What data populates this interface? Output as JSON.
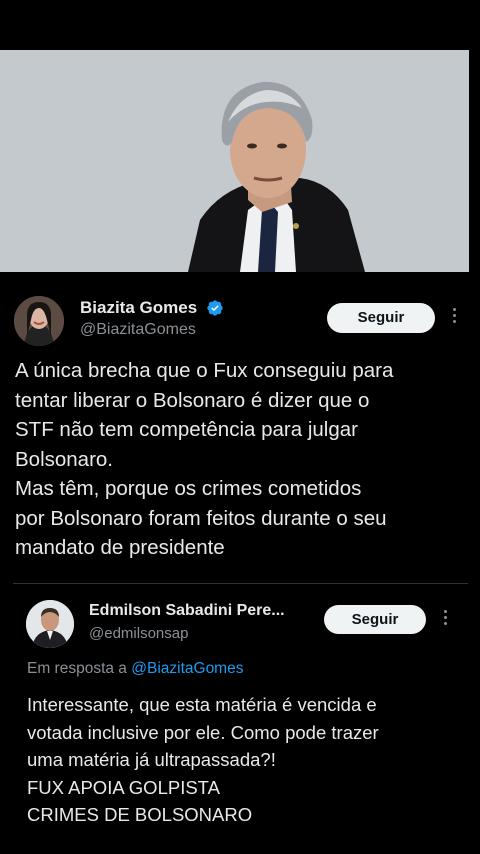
{
  "post": {
    "image_alt_icon": "photo-of-man-in-judicial-robe",
    "author": {
      "display_name": "Biazita Gomes",
      "handle": "@BiazitaGomes",
      "verified_icon": "verified-badge-icon"
    },
    "follow_label": "Seguir",
    "more_icon": "more-vertical-icon",
    "text_lines": [
      "A única brecha que o Fux  conseguiu para",
      "tentar liberar o Bolsonaro é dizer que o",
      "STF não tem competência para julgar",
      "Bolsonaro.",
      "Mas têm, porque os crimes cometidos",
      "por Bolsonaro foram feitos durante o seu",
      "mandato de presidente"
    ]
  },
  "reply": {
    "author": {
      "display_name": "Edmilson Sabadini Pere...",
      "handle": "@edmilsonsap"
    },
    "follow_label": "Seguir",
    "more_icon": "more-vertical-icon",
    "reply_to_prefix": "Em resposta a ",
    "reply_to_mention": "@BiazitaGomes",
    "text_lines": [
      "Interessante, que esta matéria é vencida e",
      "votada inclusive por ele. Como pode trazer",
      "uma matéria já ultrapassada?!",
      "FUX APOIA GOLPISTA",
      "CRIMES DE BOLSONARO"
    ]
  },
  "colors": {
    "background": "#000000",
    "text": "#e7e9ea",
    "secondary_text": "#8b9095",
    "link": "#1d9bf0",
    "verified": "#1d9bf0",
    "button_bg": "#eff3f4"
  }
}
